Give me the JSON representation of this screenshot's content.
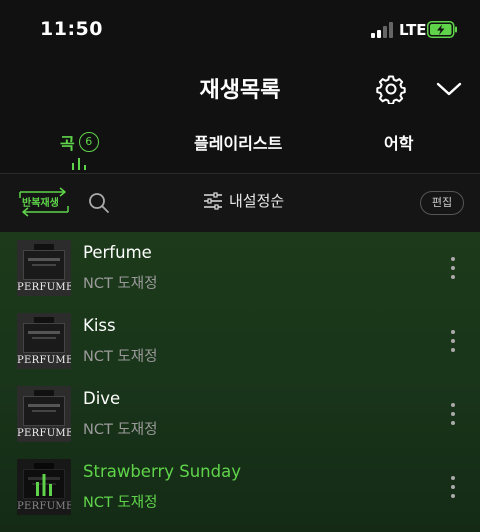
{
  "status": {
    "time": "11:50",
    "network": "LTE"
  },
  "header": {
    "title": "재생목록"
  },
  "tabs": [
    {
      "label": "곡",
      "count": "6",
      "active": true
    },
    {
      "label": "플레이리스트",
      "active": false
    },
    {
      "label": "어학",
      "active": false
    }
  ],
  "toolbar": {
    "repeat_label": "반복재생",
    "sort_label": "내설정순",
    "edit_label": "편집"
  },
  "songs": [
    {
      "title": "Perfume",
      "artist": "NCT 도재정",
      "album_text": "PERFUME",
      "playing": false
    },
    {
      "title": "Kiss",
      "artist": "NCT 도재정",
      "album_text": "PERFUME",
      "playing": false
    },
    {
      "title": "Dive",
      "artist": "NCT 도재정",
      "album_text": "PERFUME",
      "playing": false
    },
    {
      "title": "Strawberry Sunday",
      "artist": "NCT 도재정",
      "album_text": "PERFUME",
      "playing": true
    }
  ],
  "colors": {
    "accent": "#5fd44a",
    "background": "#111111",
    "list_bg": "#1d3a1a"
  }
}
